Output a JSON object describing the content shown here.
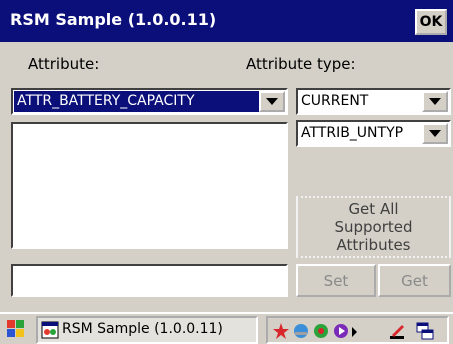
{
  "window": {
    "title": "RSM Sample (1.0.0.11)",
    "ok_label": "OK"
  },
  "form": {
    "attribute_label": "Attribute:",
    "attribute_type_label": "Attribute type:",
    "attribute_value": "ATTR_BATTERY_CAPACITY",
    "type_value": "CURRENT",
    "subtype_value": "ATTRIB_UNTYP",
    "get_all_label_line1": "Get All",
    "get_all_label_line2": "Supported",
    "get_all_label_line3": "Attributes",
    "set_label": "Set",
    "get_label": "Get",
    "value_input": ""
  },
  "taskbar": {
    "task_label": "RSM Sample (1.0.0.11)"
  },
  "colors": {
    "titlebar": "#0a0f7a",
    "face": "#d4d0c8",
    "selection": "#0a0f7a"
  }
}
